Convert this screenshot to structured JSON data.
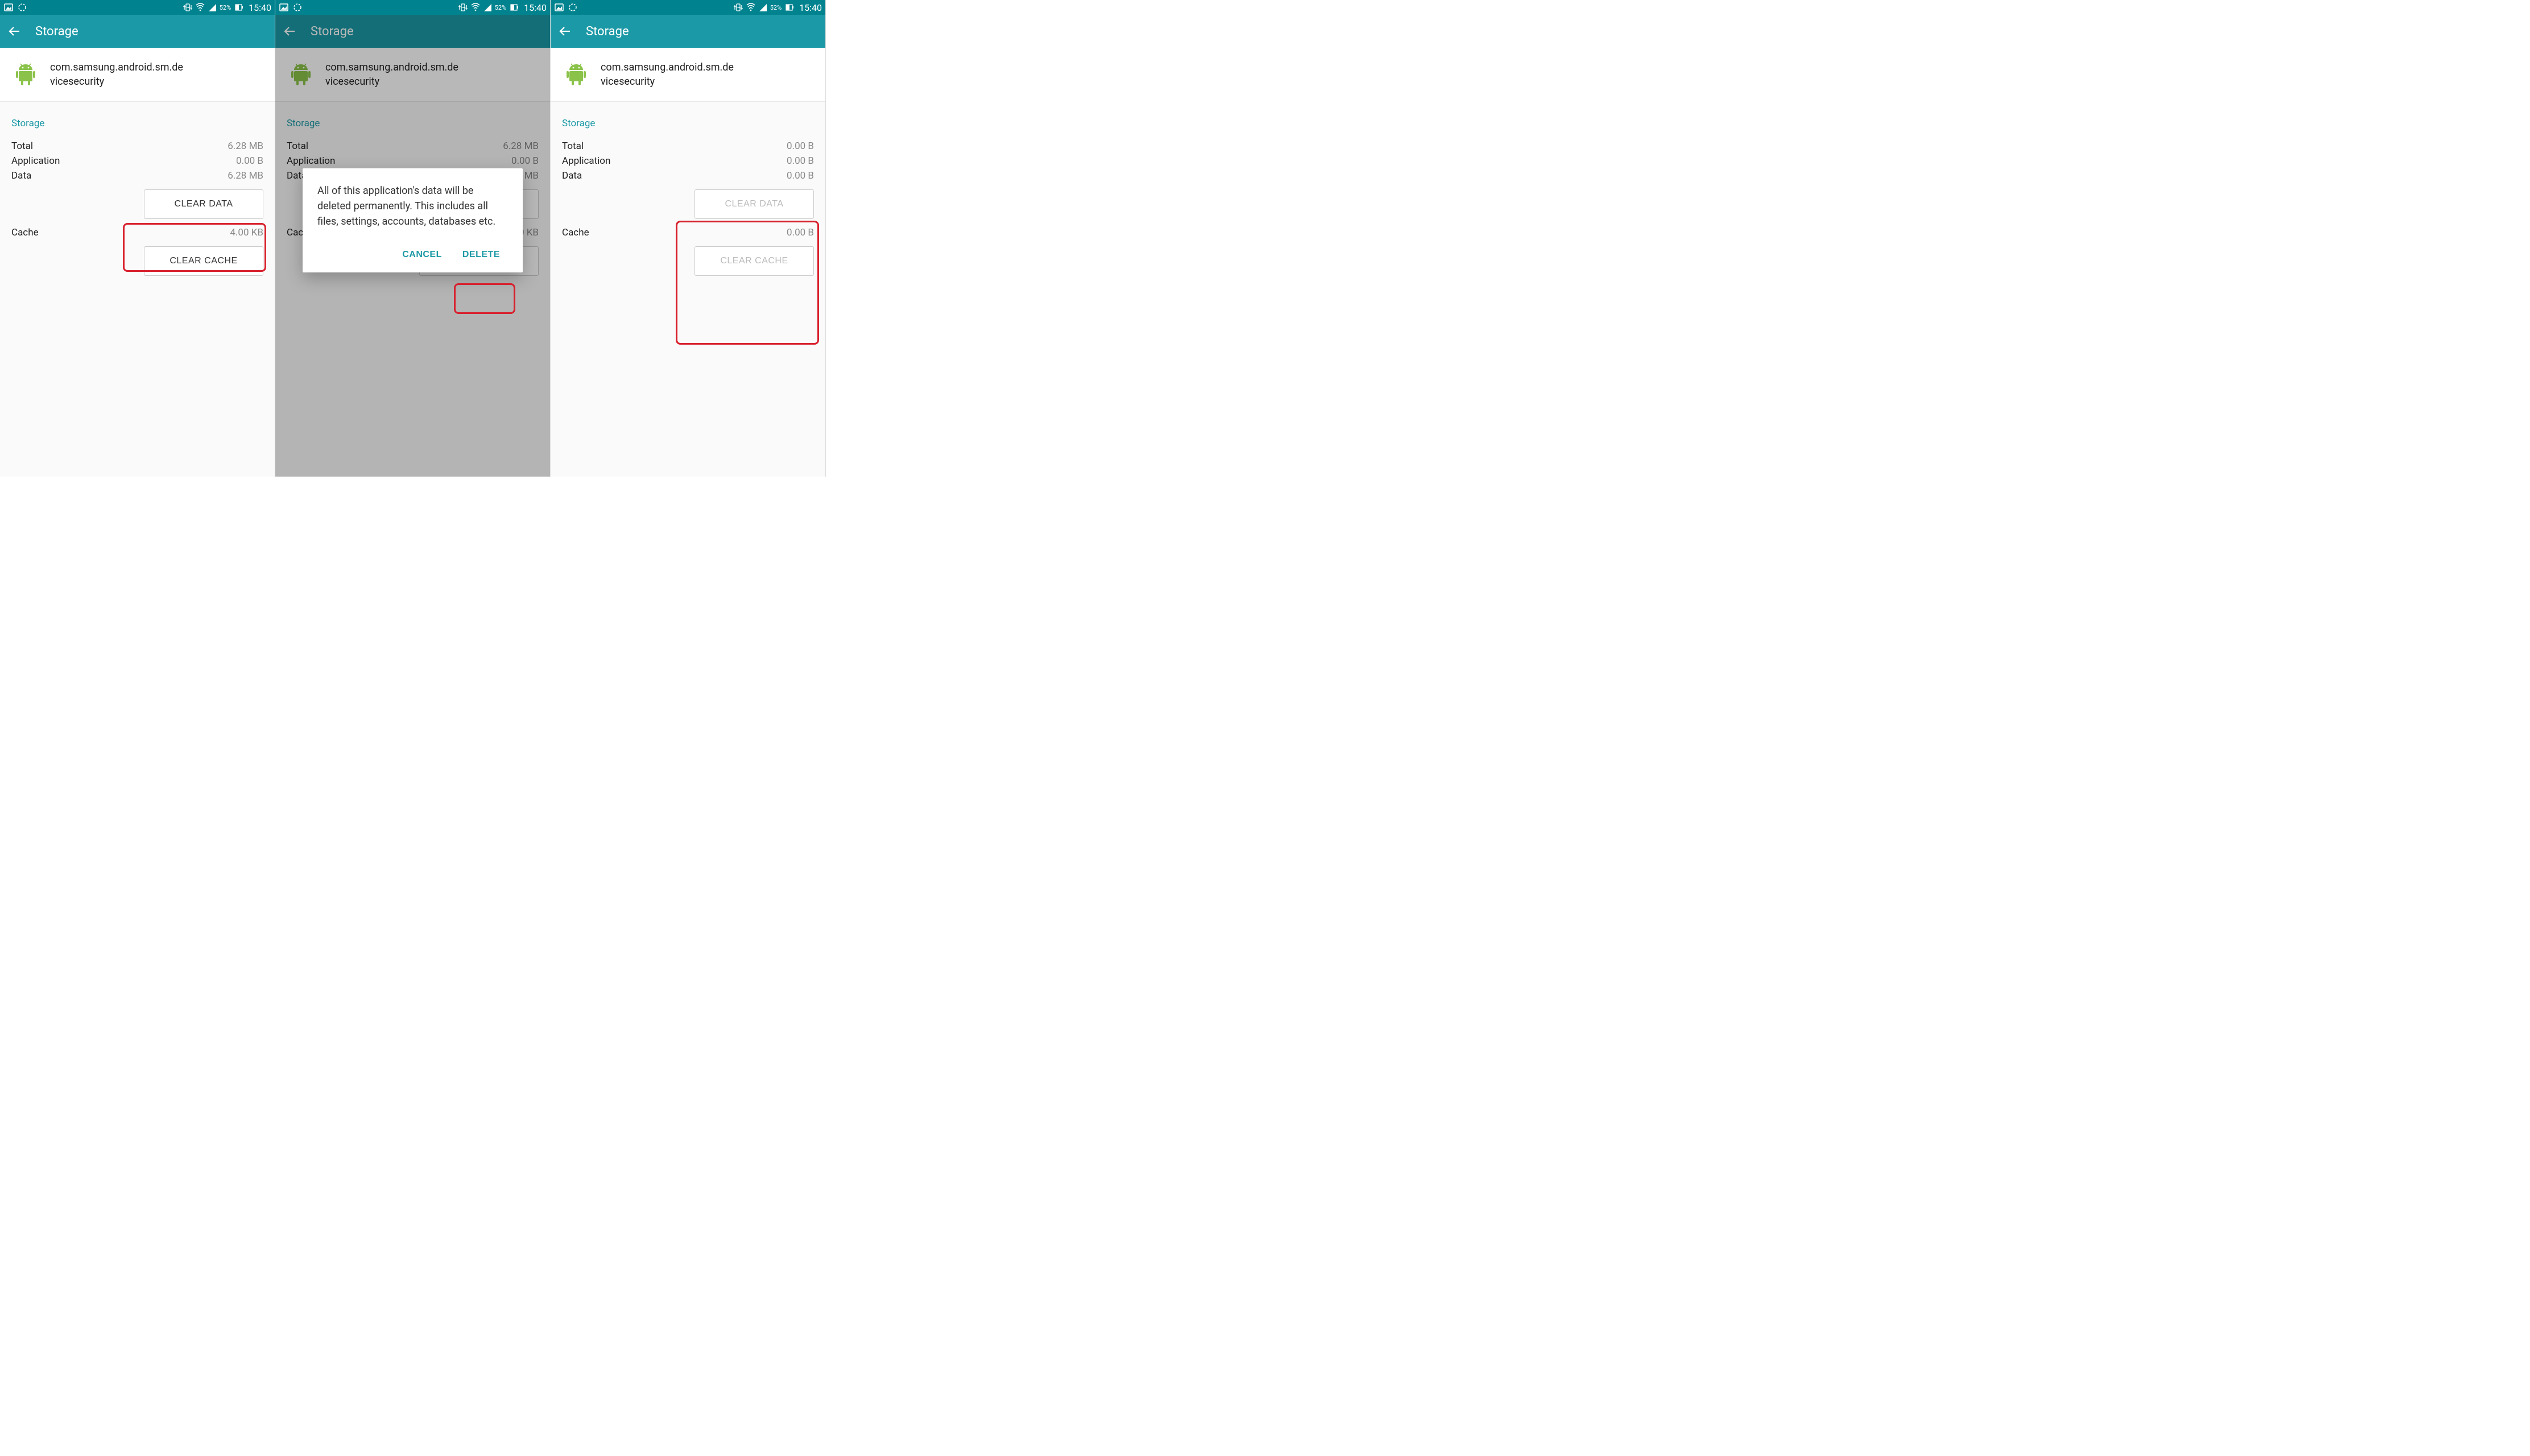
{
  "status": {
    "battery_pct": "52%",
    "time": "15:40"
  },
  "actionbar": {
    "title": "Storage"
  },
  "app": {
    "name_line1": "com.samsung.android.sm.de",
    "name_line2": "vicesecurity"
  },
  "section": {
    "title": "Storage"
  },
  "labels": {
    "total": "Total",
    "application": "Application",
    "data": "Data",
    "cache": "Cache",
    "clear_data": "CLEAR DATA",
    "clear_cache": "CLEAR CACHE"
  },
  "screen1": {
    "total": "6.28 MB",
    "application": "0.00 B",
    "data": "6.28 MB",
    "cache": "4.00 KB"
  },
  "screen3": {
    "total": "0.00 B",
    "application": "0.00 B",
    "data": "0.00 B",
    "cache": "0.00 B"
  },
  "dialog": {
    "text": "All of this application's data will be deleted permanently. This includes all files, settings, accounts, databases etc.",
    "cancel": "CANCEL",
    "delete": "DELETE"
  }
}
